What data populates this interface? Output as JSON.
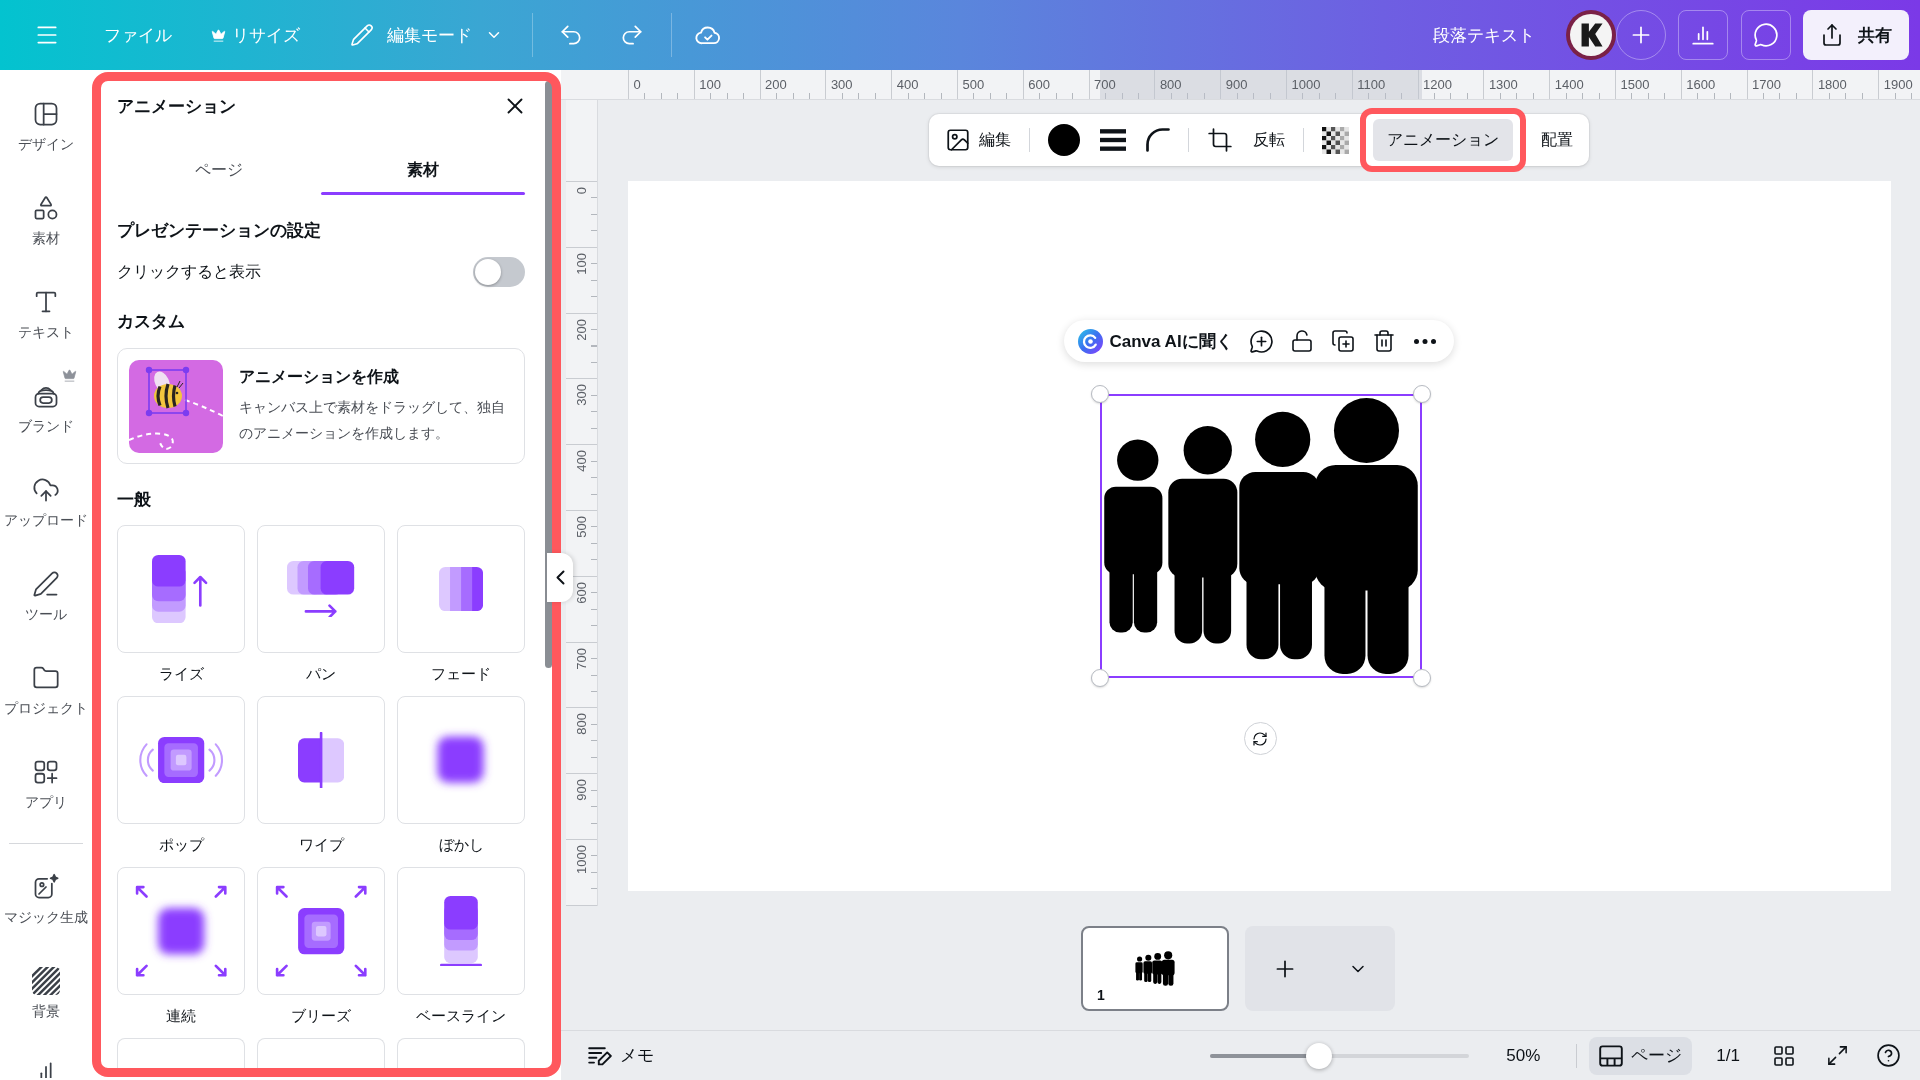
{
  "top_bar": {
    "menu": [
      {
        "label": "ファイル",
        "premium": false
      },
      {
        "label": "リサイズ",
        "premium": true
      }
    ],
    "edit_mode": "編集モード",
    "document_title": "段落テキスト",
    "share": "共有"
  },
  "sidebar": {
    "groups": [
      {
        "items": [
          {
            "kind": "design",
            "label": "デザイン",
            "selected": false,
            "premium": false
          },
          {
            "kind": "elements",
            "label": "素材",
            "selected": false,
            "premium": false
          },
          {
            "kind": "text",
            "label": "テキスト",
            "selected": false,
            "premium": false
          },
          {
            "kind": "brand",
            "label": "ブランド",
            "selected": false,
            "premium": true
          },
          {
            "kind": "uploads",
            "label": "アップロード",
            "selected": false,
            "premium": false
          },
          {
            "kind": "tools",
            "label": "ツール",
            "selected": false,
            "premium": false
          },
          {
            "kind": "projects",
            "label": "プロジェクト",
            "selected": false,
            "premium": false
          },
          {
            "kind": "apps",
            "label": "アプリ",
            "selected": false,
            "premium": false
          }
        ]
      },
      {
        "items": [
          {
            "kind": "magic",
            "label": "マジック生成",
            "selected": false,
            "premium": false
          },
          {
            "kind": "background",
            "label": "背景",
            "selected": false,
            "premium": false
          },
          {
            "kind": "chart",
            "selected": false,
            "premium": false
          }
        ]
      }
    ]
  },
  "animation_panel": {
    "highlighted": true,
    "title": "アニメーション",
    "tabs": [
      {
        "label": "ページ",
        "selected": false
      },
      {
        "label": "素材",
        "selected": true
      }
    ],
    "presentation": {
      "heading": "プレゼンテーションの設定",
      "option": {
        "label": "クリックすると表示",
        "on": false
      }
    },
    "custom": {
      "heading": "カスタム",
      "card": {
        "title": "アニメーションを作成",
        "description": "キャンバス上で素材をドラッグして、独自のアニメーションを作成します。"
      }
    },
    "general": {
      "heading": "一般",
      "effects": [
        {
          "kind": "rise",
          "label": "ライズ"
        },
        {
          "kind": "pan",
          "label": "パン"
        },
        {
          "kind": "fade",
          "label": "フェード"
        },
        {
          "kind": "pop",
          "label": "ポップ"
        },
        {
          "kind": "wipe",
          "label": "ワイプ"
        },
        {
          "kind": "blur",
          "label": "ぼかし"
        },
        {
          "kind": "continuous",
          "label": "連続"
        },
        {
          "kind": "breathe",
          "label": "ブリーズ"
        },
        {
          "kind": "baseline",
          "label": "ベースライン"
        },
        {
          "kind": "cut_off"
        },
        {
          "kind": "cut_off"
        },
        {
          "kind": "cut_off"
        }
      ]
    }
  },
  "rulers": {
    "horizontal": [
      "0",
      "100",
      "200",
      "300",
      "400",
      "500",
      "600",
      "700",
      "800",
      "900",
      "1000",
      "1100",
      "1200",
      "1300",
      "1400",
      "1500",
      "1600",
      "1700",
      "1800",
      "1900"
    ],
    "vertical": [
      "0",
      "100",
      "200",
      "300",
      "400",
      "500",
      "600",
      "700",
      "800",
      "900",
      "1000"
    ]
  },
  "context_toolbar": {
    "groups": [
      {
        "items": [
          {
            "kind": "edit",
            "label": "編集",
            "selected": false,
            "highlighted": false
          }
        ]
      },
      {
        "items": [
          {
            "kind": "color",
            "color": "#000000",
            "selected": false,
            "highlighted": false
          },
          {
            "kind": "border",
            "selected": false,
            "highlighted": false
          },
          {
            "kind": "corner",
            "selected": false,
            "highlighted": false
          }
        ]
      },
      {
        "items": [
          {
            "kind": "crop",
            "selected": false,
            "highlighted": false
          },
          {
            "kind": "flip",
            "label": "反転",
            "selected": false,
            "highlighted": false
          }
        ]
      },
      {
        "items": [
          {
            "kind": "transparency",
            "selected": false,
            "highlighted": false
          },
          {
            "kind": "animate",
            "label": "アニメーション",
            "selected": true,
            "highlighted": true
          },
          {
            "kind": "position",
            "label": "配置",
            "selected": false,
            "highlighted": false
          }
        ]
      }
    ]
  },
  "element_toolbar": {
    "ai_label": "Canva AIに聞く"
  },
  "canvas": {
    "element": {
      "kind": "people",
      "selected": true
    }
  },
  "pages": {
    "thumbnails": [
      {
        "number": "1",
        "selected": true
      }
    ]
  },
  "bottom_bar": {
    "notes": "メモ",
    "zoom": {
      "level": 0.42,
      "reading": "50%"
    },
    "page_view": {
      "label": "ページ",
      "selected": true
    },
    "page_count": "1/1"
  }
}
